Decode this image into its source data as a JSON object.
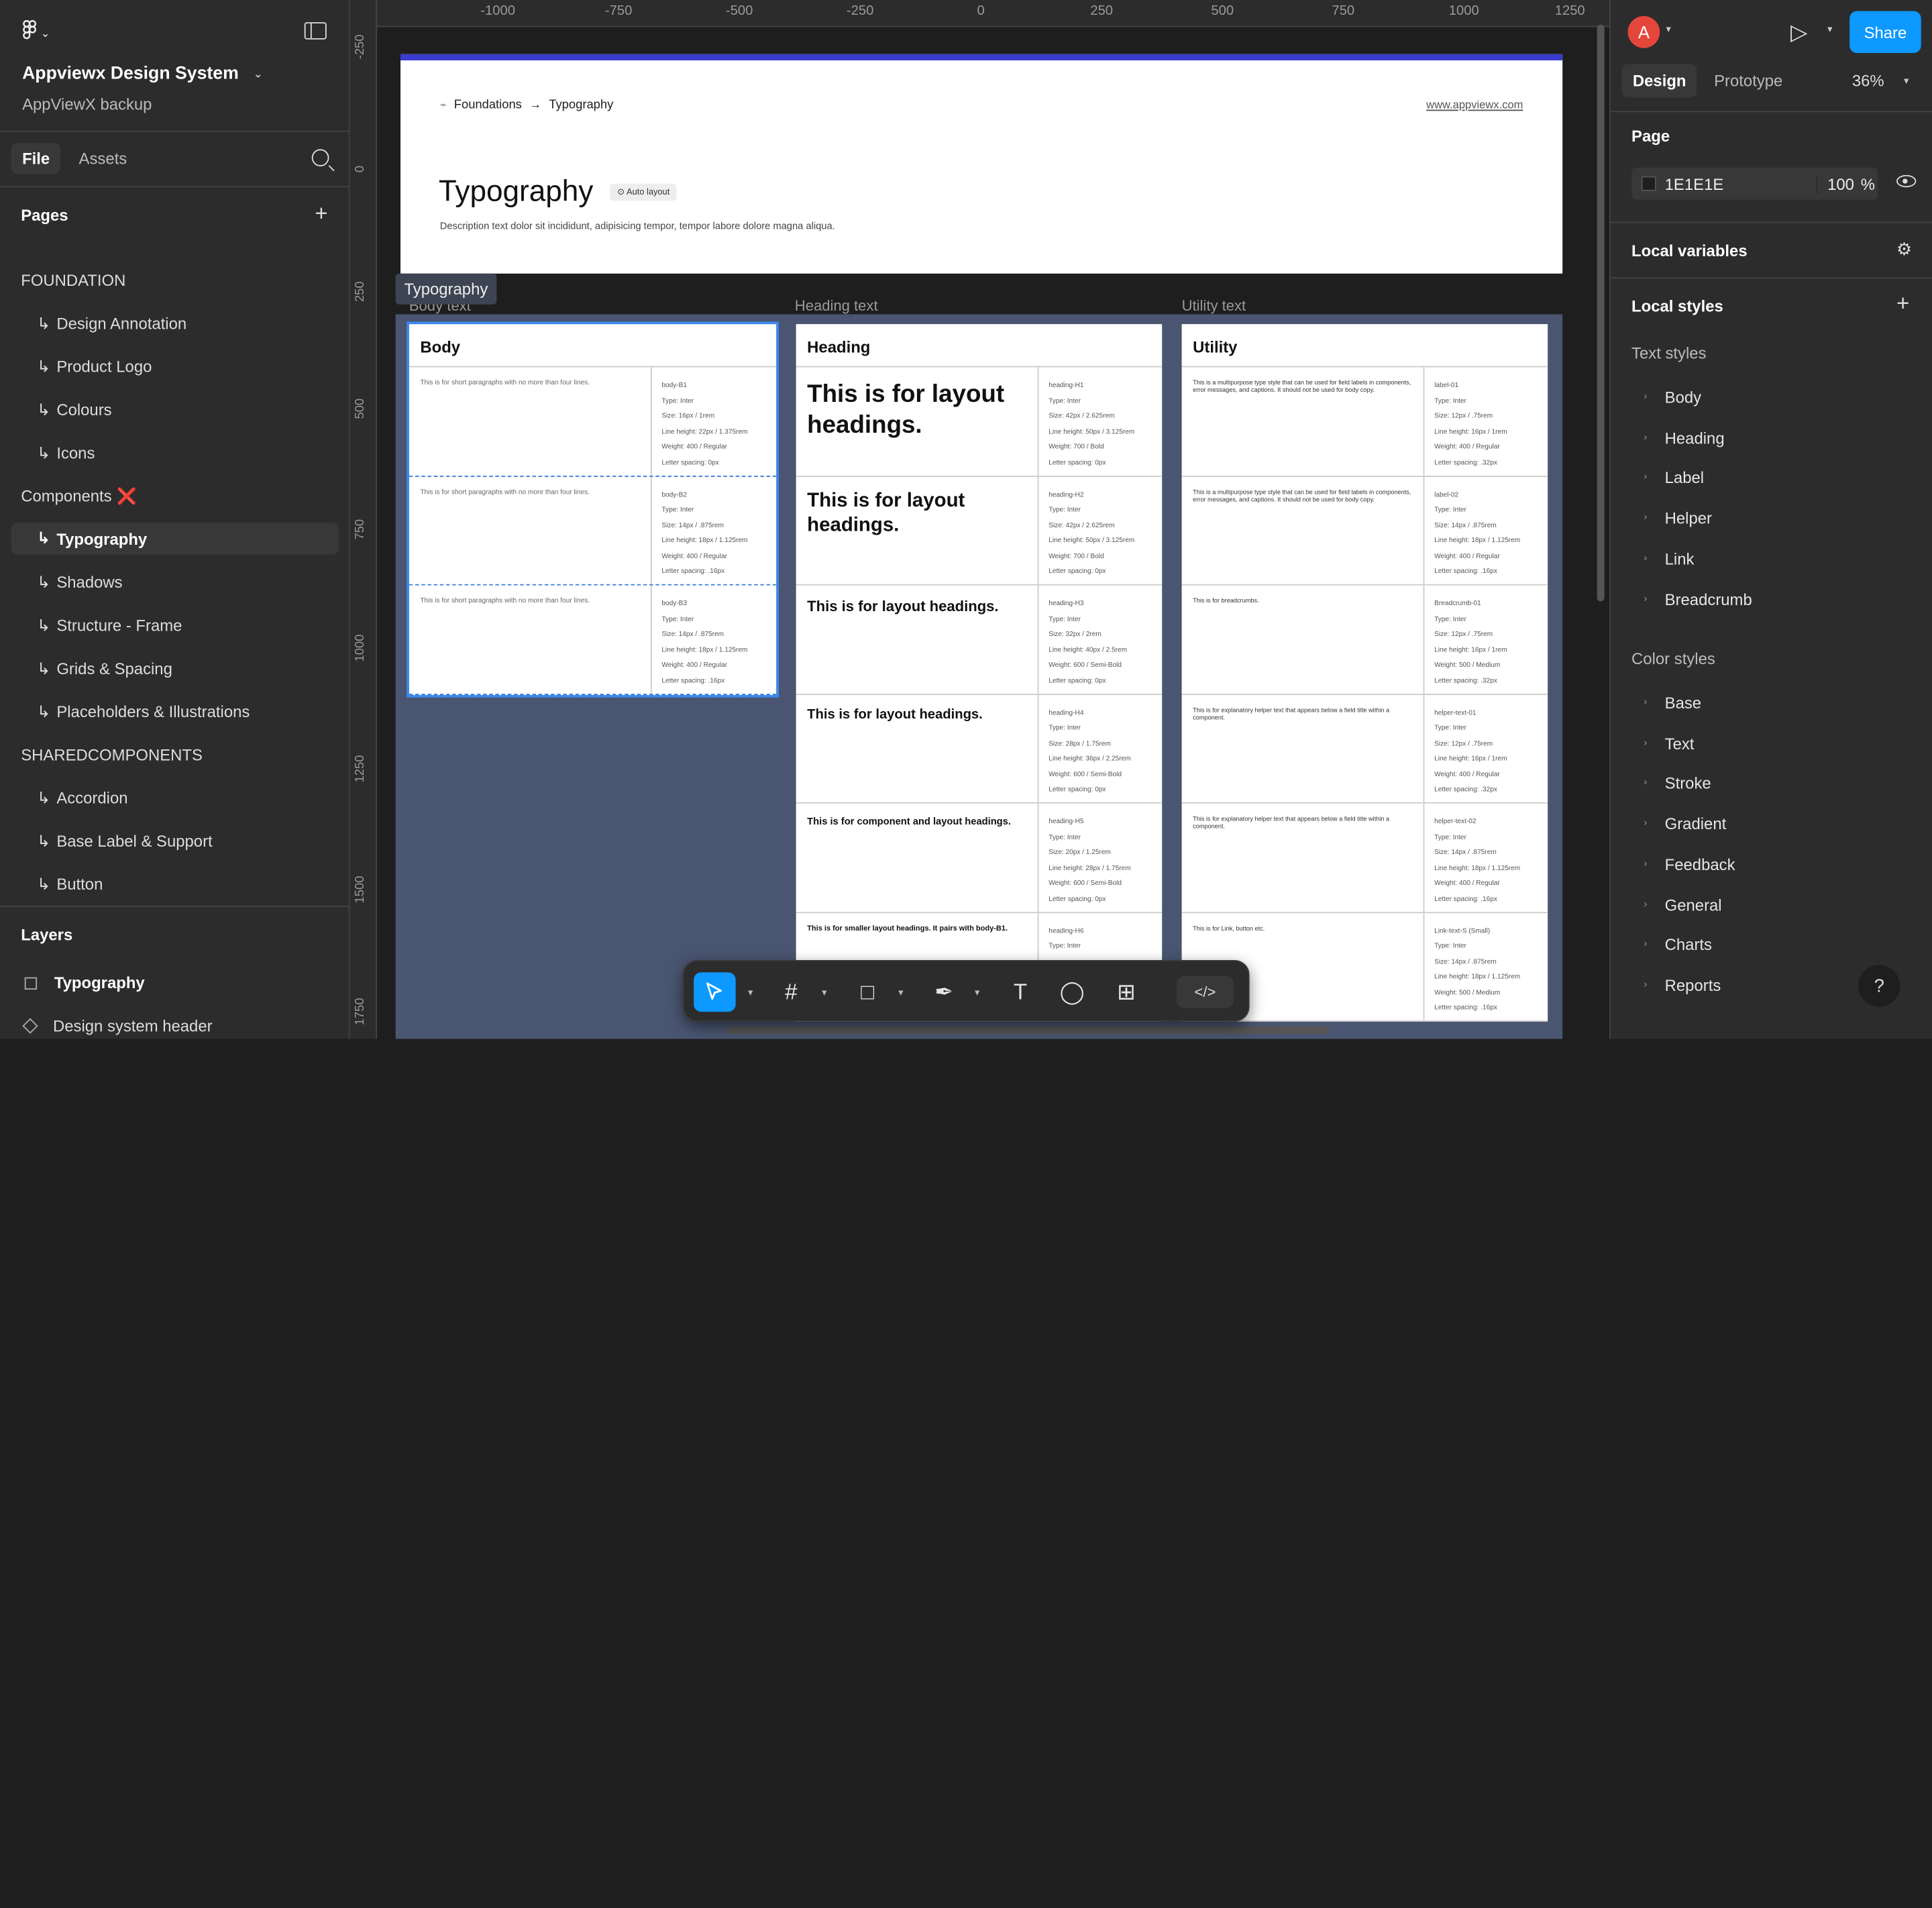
{
  "left_panel": {
    "file_title": "Appviewx Design System",
    "file_subtitle": "AppViewX backup",
    "tab_file": "File",
    "tab_assets": "Assets",
    "pages_heading": "Pages",
    "pages": [
      {
        "label": "FOUNDATION",
        "child": false
      },
      {
        "label": "Design Annotation",
        "child": true
      },
      {
        "label": "Product Logo",
        "child": true
      },
      {
        "label": "Colours",
        "child": true
      },
      {
        "label": "Icons",
        "child": true
      },
      {
        "label": "Components",
        "child": false,
        "mark": "❌"
      },
      {
        "label": "Typography",
        "child": true,
        "selected": true
      },
      {
        "label": "Shadows",
        "child": true
      },
      {
        "label": "Structure - Frame",
        "child": true
      },
      {
        "label": "Grids & Spacing",
        "child": true
      },
      {
        "label": "Placeholders & Illustrations",
        "child": true
      },
      {
        "label": "SHAREDCOMPONENTS",
        "child": false
      },
      {
        "label": "Accordion",
        "child": true
      },
      {
        "label": "Base Label & Support",
        "child": true
      },
      {
        "label": "Button",
        "child": true
      }
    ],
    "layers_heading": "Layers",
    "layers": [
      "Typography",
      "Design system header"
    ]
  },
  "rulers": {
    "top": [
      "-1000",
      "-750",
      "-500",
      "-250",
      "0",
      "250",
      "500",
      "750",
      "1000",
      "1250"
    ],
    "left": [
      "-250",
      "0",
      "250",
      "500",
      "750",
      "1000",
      "1250",
      "1500",
      "1750"
    ]
  },
  "frame_header": {
    "breadcrumb_from": "Foundations",
    "breadcrumb_arrow": "→",
    "breadcrumb_to": "Typography",
    "site": "www.appviewx.com",
    "title": "Typography",
    "badge": "Auto layout",
    "description": "Description text dolor sit incididunt, adipisicing tempor, tempor labore dolore magna aliqua."
  },
  "frame_tag": "Typography",
  "section_labels": {
    "body": "Body text",
    "heading": "Heading text",
    "utility": "Utility text"
  },
  "columns": {
    "body": {
      "title": "Body",
      "rows": [
        {
          "sample": "This is for short paragraphs with no more than four lines.",
          "spec": [
            "body-B1",
            "Type: Inter",
            "Size: 16px / 1rem",
            "Line height: 22px / 1.375rem",
            "Weight: 400 / Regular",
            "Letter spacing: 0px"
          ]
        },
        {
          "sample": "This is for short paragraphs with no more than four lines.",
          "spec": [
            "body-B2",
            "Type: Inter",
            "Size: 14px / .875rem",
            "Line height: 18px / 1.125rem",
            "Weight: 400 / Regular",
            "Letter spacing: .16px"
          ]
        },
        {
          "sample": "This is for short paragraphs with no more than four lines.",
          "spec": [
            "body-B3",
            "Type: Inter",
            "Size: 14px / .875rem",
            "Line height: 18px / 1.125rem",
            "Weight: 400 / Regular",
            "Letter spacing: .16px"
          ]
        }
      ]
    },
    "heading": {
      "title": "Heading",
      "rows": [
        {
          "sample": "This is for layout headings.",
          "spec": [
            "heading-H1",
            "Type: Inter",
            "Size: 42px / 2.625rem",
            "Line height: 50px / 3.125rem",
            "Weight: 700 / Bold",
            "Letter spacing: 0px"
          ]
        },
        {
          "sample": "This is for layout headings.",
          "spec": [
            "heading-H2",
            "Type: Inter",
            "Size: 42px / 2.625rem",
            "Line height: 50px / 3.125rem",
            "Weight: 700 / Bold",
            "Letter spacing: 0px"
          ]
        },
        {
          "sample": "This is for layout headings.",
          "spec": [
            "heading-H3",
            "Type: Inter",
            "Size: 32px / 2rem",
            "Line height: 40px / 2.5rem",
            "Weight: 600 / Semi-Bold",
            "Letter spacing: 0px"
          ]
        },
        {
          "sample": "This is for layout headings.",
          "spec": [
            "heading-H4",
            "Type: Inter",
            "Size: 28px / 1.75rem",
            "Line height: 36px / 2.25rem",
            "Weight: 600 / Semi-Bold",
            "Letter spacing: 0px"
          ]
        },
        {
          "sample": "This is for component and layout headings.",
          "spec": [
            "heading-H5",
            "Type: Inter",
            "Size: 20px / 1.25rem",
            "Line height: 28px / 1.75rem",
            "Weight: 600 / Semi-Bold",
            "Letter spacing: 0px"
          ]
        },
        {
          "sample": "This is for smaller layout headings. It pairs with body-B1.",
          "spec": [
            "heading-H6",
            "Type: Inter"
          ]
        }
      ]
    },
    "utility": {
      "title": "Utility",
      "rows": [
        {
          "sample": "This is a multipurpose type style that can be used for field labels in components, error messages, and captions. It should not be used for body copy.",
          "spec": [
            "label-01",
            "Type: Inter",
            "Size: 12px / .75rem",
            "Line height: 16px / 1rem",
            "Weight: 400 / Regular",
            "Letter spacing: .32px"
          ]
        },
        {
          "sample": "This is a multipurpose type style that can be used for field labels in components, error messages, and captions. It should not be used for body copy.",
          "spec": [
            "label-02",
            "Type: Inter",
            "Size: 14px / .875rem",
            "Line height: 18px / 1.125rem",
            "Weight: 400 / Regular",
            "Letter spacing: .16px"
          ]
        },
        {
          "sample": "This is for breadcrumbs.",
          "spec": [
            "Breadcrumb-01",
            "Type: Inter",
            "Size: 12px / .75rem",
            "Line height: 16px / 1rem",
            "Weight: 500 / Medium",
            "Letter spacing: .32px"
          ]
        },
        {
          "sample": "This is for explanatory helper text that appears below a field title within a component.",
          "spec": [
            "helper-text-01",
            "Type: Inter",
            "Size: 12px / .75rem",
            "Line height: 16px / 1rem",
            "Weight: 400 / Regular",
            "Letter spacing: .32px"
          ]
        },
        {
          "sample": "This is for explanatory helper text that appears below a field title within a component.",
          "spec": [
            "helper-text-02",
            "Type: Inter",
            "Size: 14px / .875rem",
            "Line height: 18px / 1.125rem",
            "Weight: 400 / Regular",
            "Letter spacing: .16px"
          ]
        },
        {
          "sample": "This is for Link, button etc.",
          "spec": [
            "Link-text-S (Small)",
            "Type: Inter",
            "Size: 14px / .875rem",
            "Line height: 18px / 1.125rem",
            "Weight: 500 / Medium",
            "Letter spacing: .16px"
          ]
        }
      ]
    }
  },
  "toolbar": {
    "tools": [
      "move-tool",
      "frame-tool",
      "shape-tool",
      "pen-tool",
      "text-tool",
      "comment-tool",
      "actions-tool"
    ],
    "code_label": "</>"
  },
  "right_panel": {
    "avatar_initial": "A",
    "share_label": "Share",
    "tab_design": "Design",
    "tab_prototype": "Prototype",
    "zoom": "36%",
    "page_heading": "Page",
    "page_color_hex": "1E1E1E",
    "page_opacity": "100",
    "page_opacity_unit": "%",
    "local_variables": "Local variables",
    "local_styles": "Local styles",
    "text_styles_heading": "Text styles",
    "text_styles": [
      "Body",
      "Heading",
      "Label",
      "Helper",
      "Link",
      "Breadcrumb"
    ],
    "color_styles_heading": "Color styles",
    "color_styles": [
      "Base",
      "Text",
      "Stroke",
      "Gradient",
      "Feedback",
      "General",
      "Charts",
      "Reports"
    ],
    "help": "?"
  },
  "colors": {
    "accent": "#0d99ff",
    "canvas": "#1e1e1e",
    "panel": "#2c2c2c",
    "frame_border": "#3b3bcf",
    "typo_bg": "#4a5571"
  }
}
